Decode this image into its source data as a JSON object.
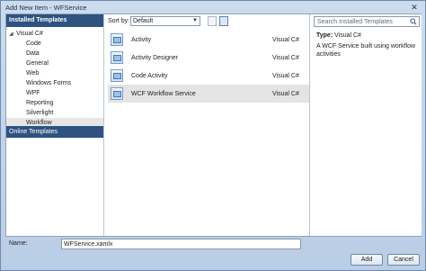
{
  "window": {
    "title": "Add New Item - WFService",
    "close_glyph": "✕"
  },
  "left": {
    "installed_header": "Installed Templates",
    "root": {
      "label": "Visual C#",
      "expander": "◢"
    },
    "items": [
      {
        "label": "Code"
      },
      {
        "label": "Data"
      },
      {
        "label": "General"
      },
      {
        "label": "Web"
      },
      {
        "label": "Windows Forms"
      },
      {
        "label": "WPF"
      },
      {
        "label": "Reporting"
      },
      {
        "label": "Silverlight"
      },
      {
        "label": "Workflow"
      }
    ],
    "online": "Online Templates"
  },
  "sortbar": {
    "label": "Sort by:",
    "selected": "Default",
    "arrow": "▼"
  },
  "templates": [
    {
      "name": "Activity",
      "language": "Visual C#",
      "icon": "activity-icon"
    },
    {
      "name": "Activity Designer",
      "language": "Visual C#",
      "icon": "activity-designer-icon"
    },
    {
      "name": "Code Activity",
      "language": "Visual C#",
      "icon": "code-activity-icon"
    },
    {
      "name": "WCF Workflow Service",
      "language": "Visual C#",
      "icon": "wcf-workflow-service-icon"
    }
  ],
  "details": {
    "search_placeholder": "Search Installed Templates",
    "type_label": "Type:",
    "type_value": "Visual C#",
    "description": "A WCF Service built using workflow activities"
  },
  "footer": {
    "name_label": "Name:",
    "name_value": "WFService.xamlx",
    "add_label": "Add",
    "cancel_label": "Cancel"
  },
  "colors": {
    "selection_header": "#2e5381",
    "chrome": "#c9d7e8",
    "selected_row": "#e4e4e4"
  }
}
